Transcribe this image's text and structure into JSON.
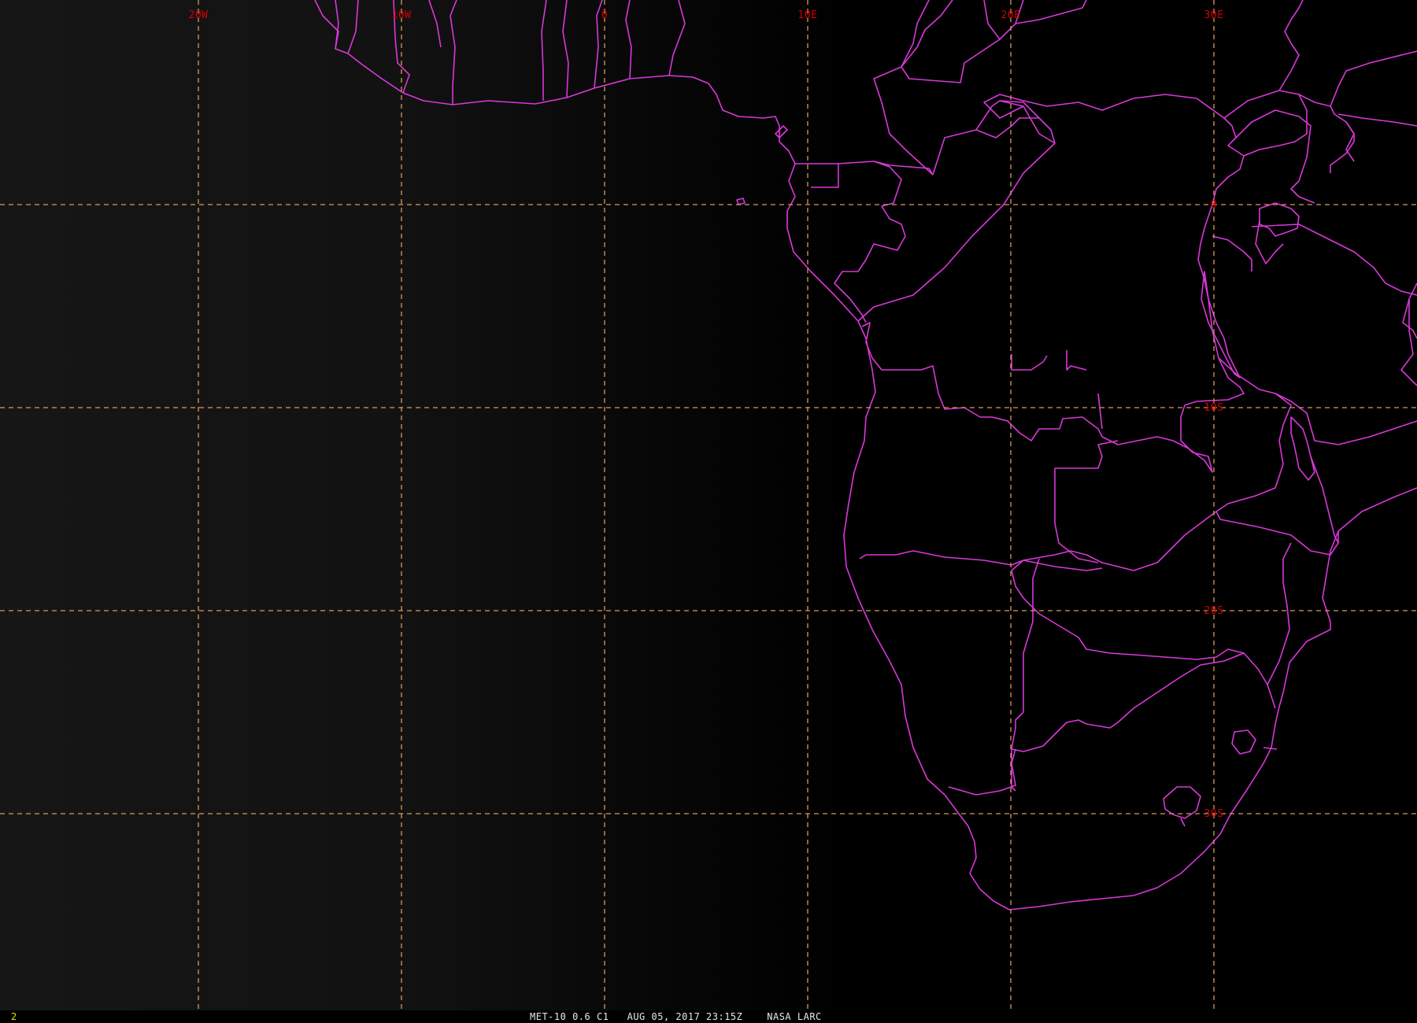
{
  "image": {
    "caption": "MET-10 0.6 C1   AUG 05, 2017 23:15Z    NASA LARC",
    "frame_number": "2"
  },
  "colors": {
    "background": "#000000",
    "night_gradient": "#161616",
    "grid": "#d89a5a",
    "grid_label": "#d40000",
    "borders": "#d838d8",
    "frame_number": "#e0e000",
    "caption": "#e8e8e8"
  },
  "grid": {
    "longitudes": [
      {
        "value": -20,
        "label": "20W"
      },
      {
        "value": -10,
        "label": "10W"
      },
      {
        "value": 0,
        "label": "0"
      },
      {
        "value": 10,
        "label": "10E"
      },
      {
        "value": 20,
        "label": "20E"
      },
      {
        "value": 30,
        "label": "30E"
      }
    ],
    "latitudes": [
      {
        "value": 0,
        "label": "0"
      },
      {
        "value": -10,
        "label": "10S"
      },
      {
        "value": -20,
        "label": "20S"
      },
      {
        "value": -30,
        "label": "30S"
      }
    ],
    "style": "dashed"
  },
  "map": {
    "region": "Western and Southern Africa",
    "projection": "geostationary view",
    "overlays": [
      "coastlines",
      "country-borders",
      "lat-lon-grid"
    ]
  }
}
